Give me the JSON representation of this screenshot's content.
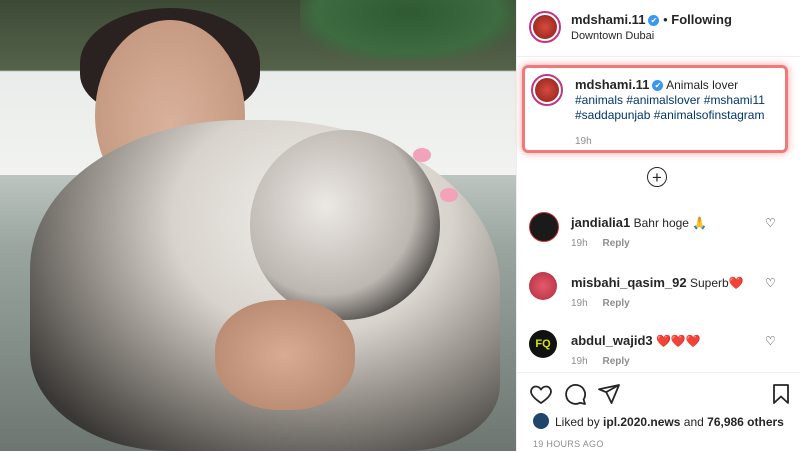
{
  "post": {
    "author": "mdshami.11",
    "verified_mark": "✔",
    "separator": "•",
    "follow_status": "Following",
    "location": "Downtown Dubai"
  },
  "caption": {
    "author": "mdshami.11",
    "text": "Animals lover",
    "tags": [
      "#animals",
      "#animalslover",
      "#mshami11",
      "#saddapunjab",
      "#animalsofinstagram"
    ],
    "time": "19h",
    "highlight_color": "#f07a7a"
  },
  "load_more_symbol": "+",
  "comments": [
    {
      "user": "jandialia1",
      "text": "Bahr hoge",
      "emoji": "🙏",
      "time": "19h",
      "reply": "Reply",
      "avatar_color": "#1a1a1a"
    },
    {
      "user": "misbahi_qasim_92",
      "text": "Superb",
      "emoji": "❤️",
      "time": "19h",
      "reply": "Reply",
      "avatar_color": "#d9475b"
    },
    {
      "user": "abdul_wajid3",
      "text": "",
      "emoji": "❤️❤️❤️",
      "time": "19h",
      "reply": "Reply",
      "avatar_color": "#111111"
    }
  ],
  "actions": {
    "icons": [
      "heart-icon",
      "comment-icon",
      "share-icon",
      "bookmark-icon"
    ]
  },
  "likes": {
    "prefix": "Liked by",
    "first_user": "ipl.2020.news",
    "connector": "and",
    "others": "76,986 others"
  },
  "timestamp": "19 HOURS AGO",
  "colors": {
    "link": "#00376b",
    "verified": "#3897f0",
    "muted": "#8e8e8e"
  }
}
